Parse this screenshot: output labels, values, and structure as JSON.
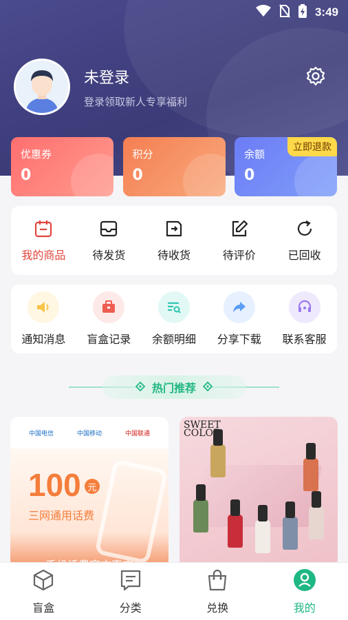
{
  "status_bar": {
    "time": "3:49"
  },
  "profile": {
    "name": "未登录",
    "subtitle": "登录领取新人专享福利"
  },
  "cards": {
    "coupon": {
      "label": "优惠券",
      "value": "0"
    },
    "points": {
      "label": "积分",
      "value": "0"
    },
    "balance": {
      "label": "余额",
      "value": "0",
      "tag": "立即退款"
    }
  },
  "orders": [
    {
      "label": "我的商品",
      "icon": "calendar-icon"
    },
    {
      "label": "待发货",
      "icon": "inbox-icon"
    },
    {
      "label": "待收货",
      "icon": "package-arrow-icon"
    },
    {
      "label": "待评价",
      "icon": "edit-icon"
    },
    {
      "label": "已回收",
      "icon": "refresh-icon"
    }
  ],
  "services": [
    {
      "label": "通知消息",
      "icon": "speaker-icon",
      "color": "#f7c348",
      "bg": "#fff7e2"
    },
    {
      "label": "盲盒记录",
      "icon": "briefcase-icon",
      "color": "#ee5d52",
      "bg": "#fde9e7"
    },
    {
      "label": "余额明细",
      "icon": "list-search-icon",
      "color": "#2fc5b2",
      "bg": "#e2f8f5"
    },
    {
      "label": "分享下载",
      "icon": "share-icon",
      "color": "#5b9df5",
      "bg": "#e6f0fe"
    },
    {
      "label": "联系客服",
      "icon": "headset-icon",
      "color": "#9a78f0",
      "bg": "#efe9fd"
    }
  ],
  "hot_section": {
    "title": "热门推荐"
  },
  "products": {
    "phone_credit": {
      "telcos": [
        "中国电信",
        "中国移动",
        "中国联通"
      ],
      "amount": "100",
      "currency": "元",
      "subtitle": "三网通用话费",
      "footer": "手机话费官方直充"
    },
    "nail_polish": {
      "brand": "SWEET COLOR"
    }
  },
  "tabbar": [
    {
      "label": "盲盒",
      "icon": "cube-icon",
      "active": false
    },
    {
      "label": "分类",
      "icon": "category-icon",
      "active": false
    },
    {
      "label": "兑换",
      "icon": "shopping-bag-icon",
      "active": false
    },
    {
      "label": "我的",
      "icon": "user-icon",
      "active": true
    }
  ],
  "colors": {
    "header": "#3f3f7d",
    "accent": "#1fb783",
    "active_red": "#e0463c"
  }
}
